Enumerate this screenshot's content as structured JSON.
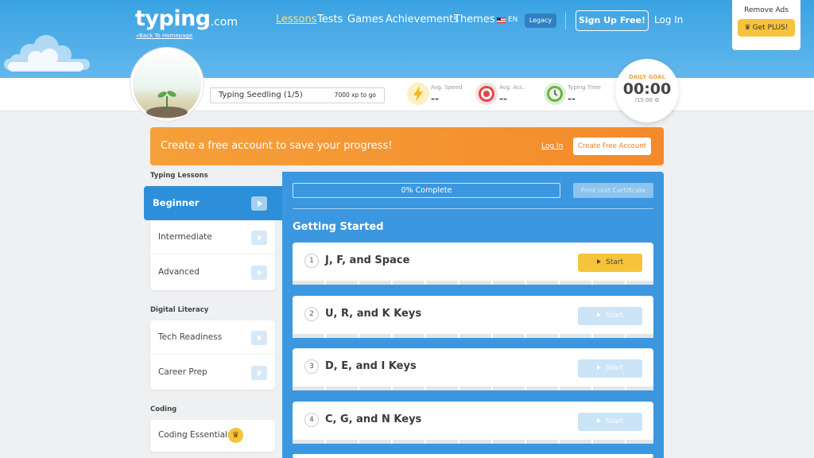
{
  "header": {
    "logo_main": "typing",
    "logo_suffix": ".com",
    "back_link": "«Back To Homepage",
    "nav": {
      "lessons": "Lessons",
      "tests": "Tests",
      "games": "Games",
      "achievements": "Achievements",
      "themes": "Themes",
      "language": "EN",
      "legacy": "Legacy"
    },
    "signup": "Sign Up Free!",
    "login": "Log In",
    "plus": {
      "remove_ads": "Remove Ads",
      "get_plus": "Get PLUS!"
    }
  },
  "profile": {
    "rank_name": "Typing Seedling (1/5)",
    "xp_to_go": "7000 xp to go",
    "stats": [
      {
        "label": "Avg. Speed",
        "value": "--",
        "icon": "lightning-icon"
      },
      {
        "label": "Avg. Acc.",
        "value": "--",
        "icon": "target-icon"
      },
      {
        "label": "Typing Time",
        "value": "--",
        "icon": "clock-icon"
      }
    ],
    "daily_goal": {
      "label": "DAILY GOAL",
      "time": "00:00",
      "target": "/15:00"
    }
  },
  "banner": {
    "text": "Create a free account to save your progress!",
    "login": "Log In",
    "create": "Create Free Account"
  },
  "sidebar": {
    "sections": [
      {
        "title": "Typing Lessons",
        "items": [
          "Beginner",
          "Intermediate",
          "Advanced"
        ]
      },
      {
        "title": "Digital Literacy",
        "items": [
          "Tech Readiness",
          "Career Prep"
        ]
      },
      {
        "title": "Coding",
        "items": [
          "Coding Essentials"
        ]
      }
    ],
    "selected": "Beginner"
  },
  "main": {
    "progress": "0% Complete",
    "certificate": "Print Unit Certificate",
    "section_title": "Getting Started",
    "start_label": "Start",
    "lessons": [
      {
        "num": "1",
        "name": "J, F, and Space",
        "active": true
      },
      {
        "num": "2",
        "name": "U, R, and K Keys",
        "active": false
      },
      {
        "num": "3",
        "name": "D, E, and I Keys",
        "active": false
      },
      {
        "num": "4",
        "name": "C, G, and N Keys",
        "active": false
      }
    ]
  },
  "colors": {
    "brand_blue": "#3aa3e3",
    "accent_orange": "#f48a2a",
    "start_yellow": "#f6c33b"
  }
}
